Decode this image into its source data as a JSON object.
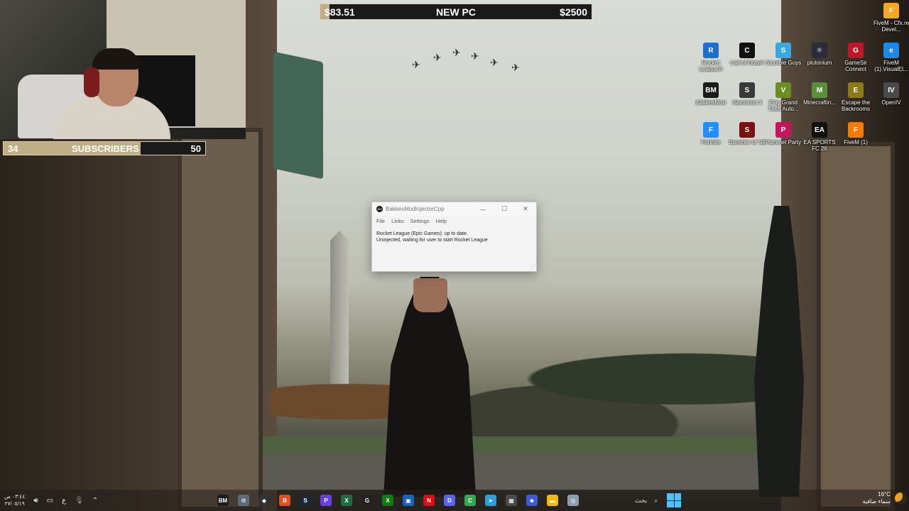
{
  "overlay": {
    "goal": {
      "current": "$83.51",
      "label": "NEW PC",
      "target": "$2500",
      "progress": 0.0334
    },
    "subscribers": {
      "current": "34",
      "label": "SUBSCRIBERS",
      "target": "50",
      "progress": 0.68
    }
  },
  "desktop": {
    "icons": [
      {
        "label": "FiveM - Cfx.re Devel...",
        "glyph": "F",
        "color": "#f5a623"
      },
      {
        "label": "Rocket League®",
        "glyph": "R",
        "color": "#1f6fd1"
      },
      {
        "label": "Call of Duty®",
        "glyph": "C",
        "color": "#111111"
      },
      {
        "label": "Stumble Guys",
        "glyph": "S",
        "color": "#3aa7e0"
      },
      {
        "label": "plutonium",
        "glyph": "⚛",
        "color": "#2b2b3a"
      },
      {
        "label": "GameSir Connect",
        "glyph": "G",
        "color": "#c0182a"
      },
      {
        "label": "FiveM (1).VisualEl...",
        "glyph": "e",
        "color": "#1e88e5"
      },
      {
        "label": "BakkesMod",
        "glyph": "BM",
        "color": "#1b1b1b"
      },
      {
        "label": "Samorost 3",
        "glyph": "S",
        "color": "#3a3a3a"
      },
      {
        "label": "Play Grand Theft Auto...",
        "glyph": "V",
        "color": "#6b8e23"
      },
      {
        "label": "Minecraftin...",
        "glyph": "M",
        "color": "#5a8f3c"
      },
      {
        "label": "Escape the Backrooms",
        "glyph": "E",
        "color": "#8b7a1a"
      },
      {
        "label": "OpenIV",
        "glyph": "IV",
        "color": "#4a4a4a"
      },
      {
        "label": "Fortnite",
        "glyph": "F",
        "color": "#1e90ff"
      },
      {
        "label": "Summer of '58",
        "glyph": "S",
        "color": "#7a1010"
      },
      {
        "label": "Pummel Party",
        "glyph": "P",
        "color": "#c2185b"
      },
      {
        "label": "EA SPORTS FC 26",
        "glyph": "EA",
        "color": "#111111"
      },
      {
        "label": "FiveM (1)",
        "glyph": "F",
        "color": "#f57c00"
      }
    ]
  },
  "window": {
    "title": "BakkesModInjectorCpp",
    "app_icon": "BM",
    "menu": [
      "File",
      "Links",
      "Settings",
      "Help"
    ],
    "status_line1": "Rocket League (Epic Games): up to date.",
    "status_line2": "Uninjected, waiting for user to start Rocket League"
  },
  "taskbar": {
    "clock_time": "٠٣:٤٤ ص",
    "clock_date": "٢٧/٠٥/١٩",
    "lang": "ع",
    "search_label": "بحث",
    "weather_temp": "16°C",
    "weather_desc": "سماء صافية",
    "apps": [
      {
        "name": "bakkesmod",
        "glyph": "BM",
        "color": "#1b1b1b"
      },
      {
        "name": "settings",
        "glyph": "⚙",
        "color": "#5a6b7c"
      },
      {
        "name": "unity",
        "glyph": "◆",
        "color": "#333333"
      },
      {
        "name": "brave",
        "glyph": "B",
        "color": "#e0501f"
      },
      {
        "name": "steam",
        "glyph": "S",
        "color": "#1b2838"
      },
      {
        "name": "app-purple",
        "glyph": "P",
        "color": "#6a3de8"
      },
      {
        "name": "excel",
        "glyph": "X",
        "color": "#1d6f42"
      },
      {
        "name": "g-hub",
        "glyph": "G",
        "color": "#222222"
      },
      {
        "name": "xbox",
        "glyph": "X",
        "color": "#107c10"
      },
      {
        "name": "app-blue",
        "glyph": "▣",
        "color": "#1565c0"
      },
      {
        "name": "netflix",
        "glyph": "N",
        "color": "#e50914"
      },
      {
        "name": "discord",
        "glyph": "D",
        "color": "#5865f2"
      },
      {
        "name": "chrome",
        "glyph": "C",
        "color": "#34a853"
      },
      {
        "name": "telegram",
        "glyph": "➤",
        "color": "#2aa1da"
      },
      {
        "name": "store",
        "glyph": "▦",
        "color": "#4a4a4a"
      },
      {
        "name": "app-people",
        "glyph": "☻",
        "color": "#3b5bdb"
      },
      {
        "name": "file-explorer",
        "glyph": "▬",
        "color": "#f2b90c"
      },
      {
        "name": "minimap",
        "glyph": "◎",
        "color": "#8aa0b0"
      }
    ]
  }
}
